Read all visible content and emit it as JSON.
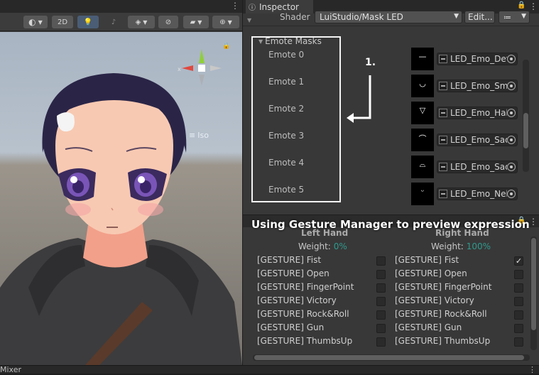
{
  "scene": {
    "toolbar": {
      "mode_2d": "2D"
    },
    "gizmo": {
      "projection_label": "Iso"
    }
  },
  "inspector": {
    "tab_title": "Inspector",
    "shader_label": "Shader",
    "shader_value": "LuiStudio/Mask LED",
    "edit_button": "Edit...",
    "section_title": "Emote Masks",
    "emotes": [
      {
        "label": "Emote 0",
        "texture": "LED_Emo_Defa",
        "glyph": "—"
      },
      {
        "label": "Emote 1",
        "texture": "LED_Emo_Smil",
        "glyph": "◡"
      },
      {
        "label": "Emote 2",
        "texture": "LED_Emo_Hah",
        "glyph": "▽"
      },
      {
        "label": "Emote 3",
        "texture": "LED_Emo_Sad",
        "glyph": "⌒"
      },
      {
        "label": "Emote 4",
        "texture": "LED_Emo_Sad",
        "glyph": "⌓"
      },
      {
        "label": "Emote 5",
        "texture": "LED_Emo_Nek",
        "glyph": "ᵕ"
      }
    ],
    "annotation_step": "1."
  },
  "gesture_manager": {
    "overlay_caption": "Using Gesture Manager to preview expression",
    "left": {
      "title": "Left Hand",
      "weight_label": "Weight:",
      "weight_value": "0%"
    },
    "right": {
      "title": "Right Hand",
      "weight_label": "Weight:",
      "weight_value": "100%"
    },
    "gestures": [
      {
        "label": "[GESTURE] Fist",
        "left_checked": false,
        "right_checked": true
      },
      {
        "label": "[GESTURE] Open",
        "left_checked": false,
        "right_checked": false
      },
      {
        "label": "[GESTURE] FingerPoint",
        "left_checked": false,
        "right_checked": false
      },
      {
        "label": "[GESTURE] Victory",
        "left_checked": false,
        "right_checked": false
      },
      {
        "label": "[GESTURE] Rock&Roll",
        "left_checked": false,
        "right_checked": false
      },
      {
        "label": "[GESTURE] Gun",
        "left_checked": false,
        "right_checked": false
      },
      {
        "label": "[GESTURE] ThumbsUp",
        "left_checked": false,
        "right_checked": false
      }
    ],
    "colors": {
      "weight_value": "#2f9a8d"
    }
  },
  "footer": {
    "mixer_tab": "Mixer"
  }
}
